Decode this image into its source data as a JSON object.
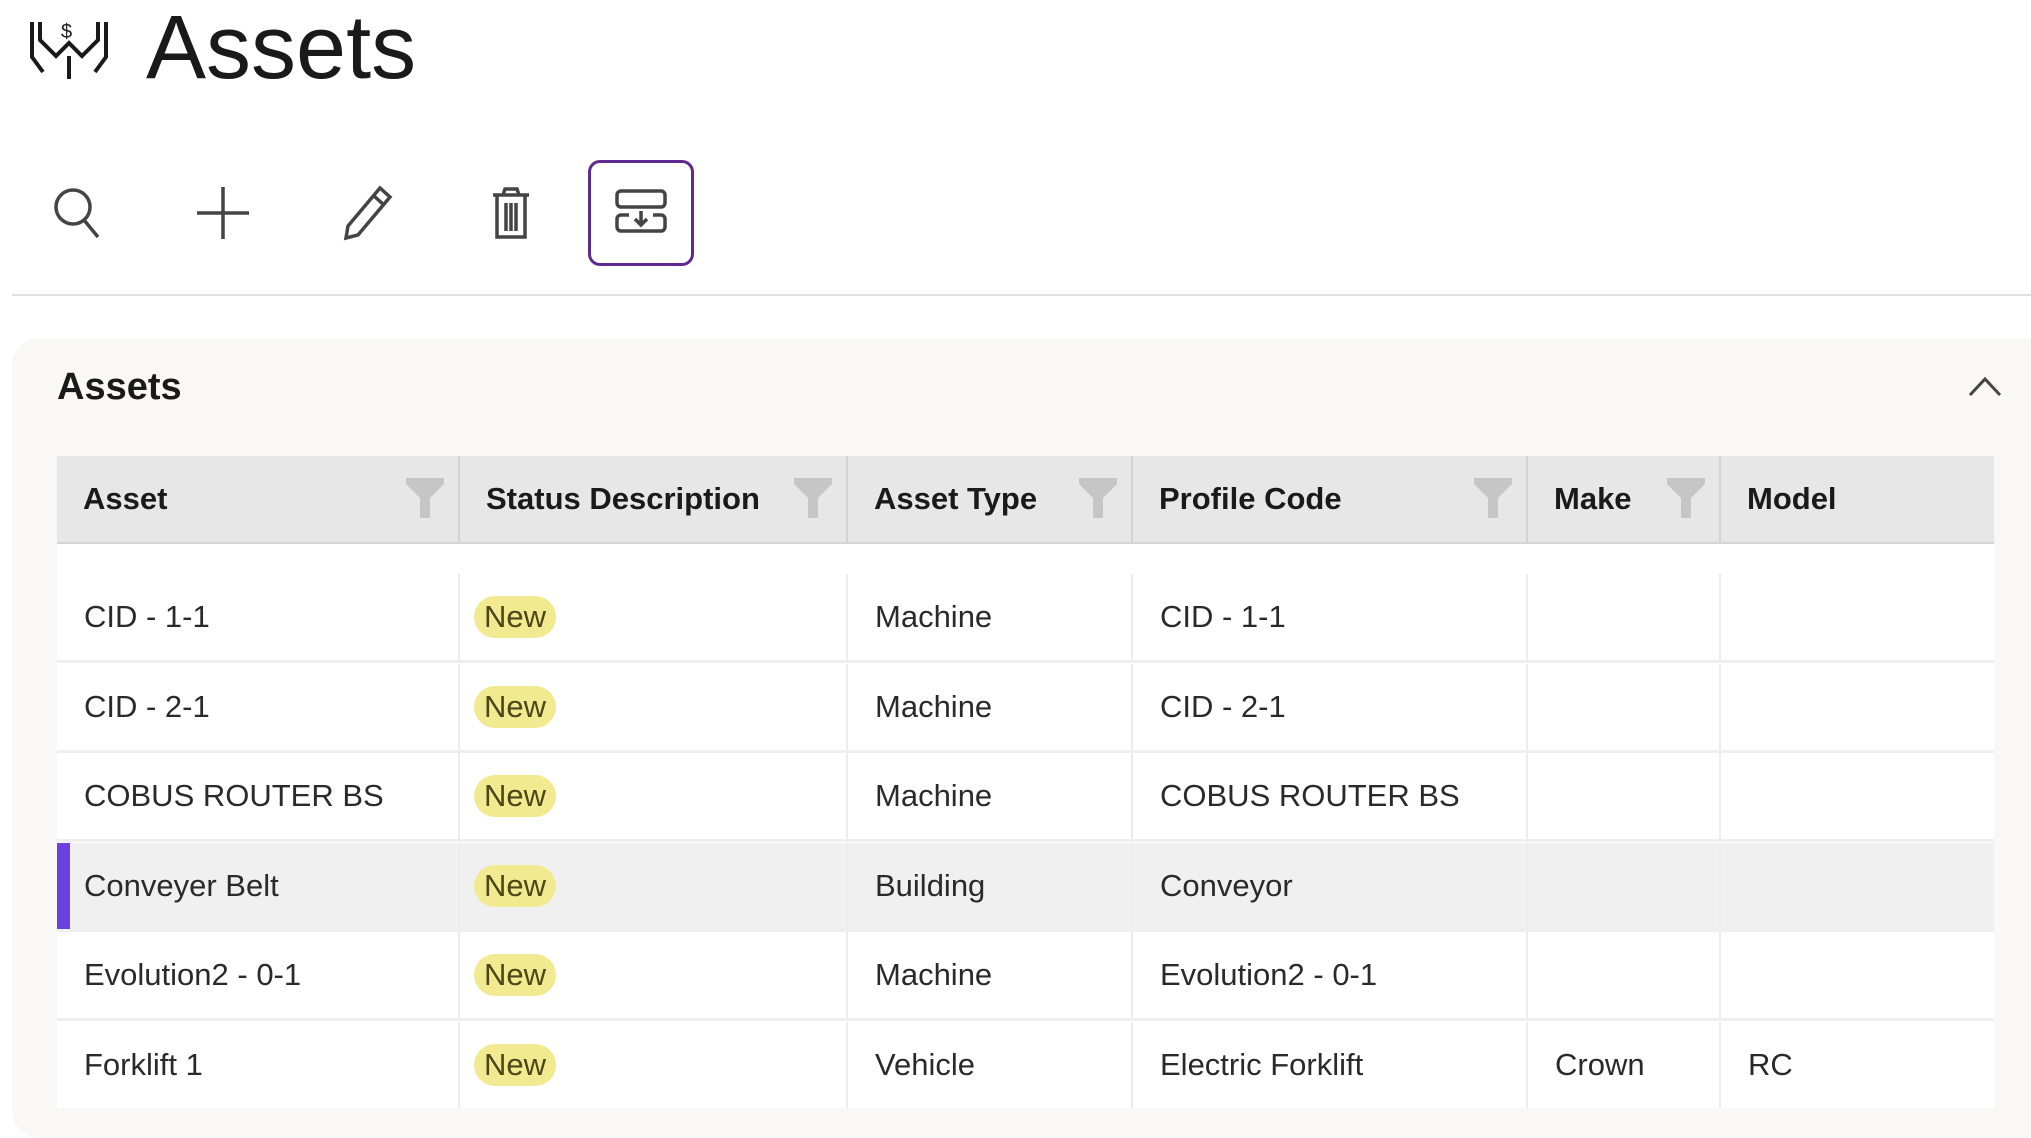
{
  "header": {
    "title": "Assets"
  },
  "toolbar": {
    "buttons": [
      "search",
      "add",
      "edit",
      "delete",
      "import"
    ]
  },
  "panel": {
    "title": "Assets"
  },
  "table": {
    "columns": [
      "Asset",
      "Status Description",
      "Asset Type",
      "Profile Code",
      "Make",
      "Model"
    ],
    "rows": [
      {
        "asset": "CID - 1-1",
        "status": "New",
        "type": "Machine",
        "profile": "CID - 1-1",
        "make": "",
        "model": ""
      },
      {
        "asset": "CID - 2-1",
        "status": "New",
        "type": "Machine",
        "profile": "CID - 2-1",
        "make": "",
        "model": ""
      },
      {
        "asset": "COBUS ROUTER BS",
        "status": "New",
        "type": "Machine",
        "profile": "COBUS ROUTER BS",
        "make": "",
        "model": ""
      },
      {
        "asset": "Conveyer Belt",
        "status": "New",
        "type": "Building",
        "profile": "Conveyor",
        "make": "",
        "model": "",
        "selected": true
      },
      {
        "asset": "Evolution2 - 0-1",
        "status": "New",
        "type": "Machine",
        "profile": "Evolution2 - 0-1",
        "make": "",
        "model": ""
      },
      {
        "asset": "Forklift 1",
        "status": "New",
        "type": "Vehicle",
        "profile": "Electric Forklift",
        "make": "Crown",
        "model": "RC"
      }
    ]
  },
  "colors": {
    "accent": "#5e2a91",
    "selected_bar": "#6b3fe0",
    "badge_bg": "#f1ea91"
  }
}
